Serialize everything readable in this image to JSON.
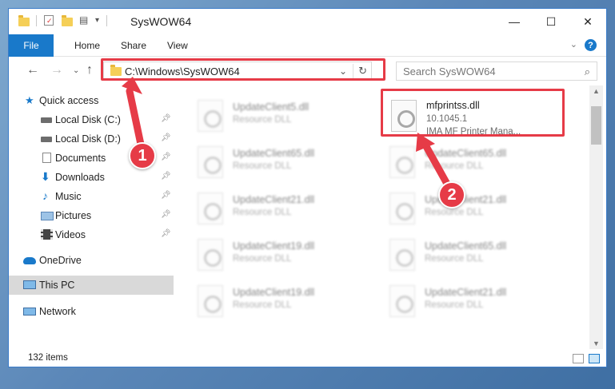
{
  "window": {
    "title": "SysWOW64"
  },
  "ribbon": {
    "tabs": [
      "File",
      "Home",
      "Share",
      "View"
    ]
  },
  "nav": {
    "address": "C:\\Windows\\SysWOW64",
    "search_placeholder": "Search SysWOW64"
  },
  "sidebar": {
    "items": [
      {
        "label": "Quick access",
        "icon": "star-icon"
      },
      {
        "label": "Local Disk (C:)",
        "icon": "drive-icon"
      },
      {
        "label": "Local Disk (D:)",
        "icon": "drive-icon"
      },
      {
        "label": "Documents",
        "icon": "documents-icon"
      },
      {
        "label": "Downloads",
        "icon": "downloads-icon"
      },
      {
        "label": "Music",
        "icon": "music-icon"
      },
      {
        "label": "Pictures",
        "icon": "pictures-icon"
      },
      {
        "label": "Videos",
        "icon": "videos-icon"
      },
      {
        "label": "OneDrive",
        "icon": "cloud-icon"
      },
      {
        "label": "This PC",
        "icon": "computer-icon"
      },
      {
        "label": "Network",
        "icon": "network-icon"
      }
    ]
  },
  "files": {
    "highlighted": {
      "name": "mfprintss.dll",
      "version": "10.1045.1",
      "description": "IMA MF Printer Mana..."
    },
    "left_column": [
      {
        "name": "UpdateClient5.dll",
        "type": "Resource DLL"
      },
      {
        "name": "UpdateClient65.dll",
        "type": "Resource DLL"
      },
      {
        "name": "UpdateClient21.dll",
        "type": "Resource DLL"
      },
      {
        "name": "UpdateClient19.dll",
        "type": "Resource DLL"
      },
      {
        "name": "UpdateClient19.dll",
        "type": "Resource DLL"
      }
    ],
    "right_column": [
      {
        "name": "UpdateClient65.dll",
        "type": "Resource DLL"
      },
      {
        "name": "UpdateClient21.dll",
        "type": "Resource DLL"
      },
      {
        "name": "UpdateClient65.dll",
        "type": "Resource DLL"
      },
      {
        "name": "UpdateClient21.dll",
        "type": "Resource DLL"
      }
    ]
  },
  "status": {
    "count": "132 items"
  },
  "annotations": {
    "callout_1": "1",
    "callout_2": "2",
    "color": "#e63b47"
  }
}
